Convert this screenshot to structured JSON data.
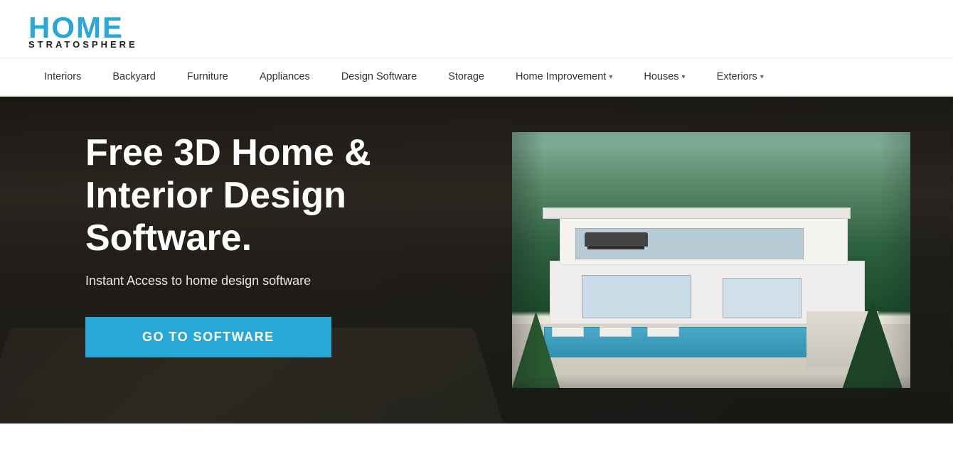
{
  "header": {
    "logo_home": "HOME",
    "logo_stratosphere": "STRATOSPHERE"
  },
  "nav": {
    "items": [
      {
        "label": "Interiors",
        "hasDropdown": false
      },
      {
        "label": "Backyard",
        "hasDropdown": false
      },
      {
        "label": "Furniture",
        "hasDropdown": false
      },
      {
        "label": "Appliances",
        "hasDropdown": false
      },
      {
        "label": "Design Software",
        "hasDropdown": false
      },
      {
        "label": "Storage",
        "hasDropdown": false
      },
      {
        "label": "Home Improvement",
        "hasDropdown": true
      },
      {
        "label": "Houses",
        "hasDropdown": true
      },
      {
        "label": "Exteriors",
        "hasDropdown": true
      }
    ]
  },
  "hero": {
    "title": "Free 3D Home & Interior Design Software.",
    "subtitle": "Instant Access to home design software",
    "cta_label": "GO TO SOFTWARE"
  }
}
